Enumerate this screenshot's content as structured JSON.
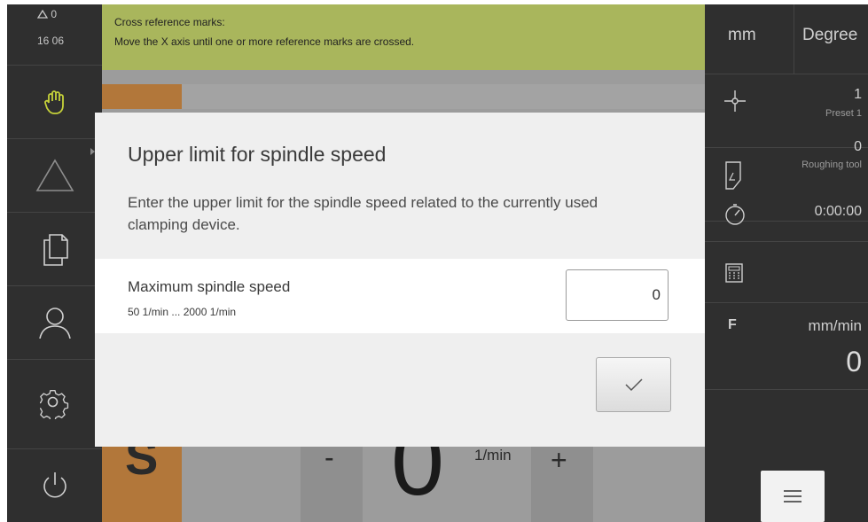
{
  "status": {
    "warning_count": "0",
    "time": "16 06"
  },
  "banner": {
    "title": "Cross reference marks:",
    "message": "Move the X axis until one or more reference marks are crossed."
  },
  "dialog": {
    "title": "Upper limit for spindle speed",
    "description": "Enter the upper limit for the spindle speed related to the currently used clamping device.",
    "field_label": "Maximum spindle speed",
    "field_range": "50 1/min ... 2000 1/min",
    "field_value": "0"
  },
  "spindle": {
    "letter": "S",
    "minus_label": "-",
    "value": "0",
    "unit": "1/min",
    "plus_label": "+"
  },
  "right_panel": {
    "unit_length": "mm",
    "unit_angle": "Degree",
    "preset_value": "1",
    "preset_label": "Preset 1",
    "tool_value": "0",
    "tool_label": "Roughing tool",
    "timer_value": "0:00:00",
    "feed_letter": "F",
    "feed_unit": "mm/min",
    "feed_value": "0"
  },
  "colors": {
    "banner": "#a9b65c",
    "spindle_accent": "#b2773a",
    "sidebar": "#2f2f2f"
  }
}
